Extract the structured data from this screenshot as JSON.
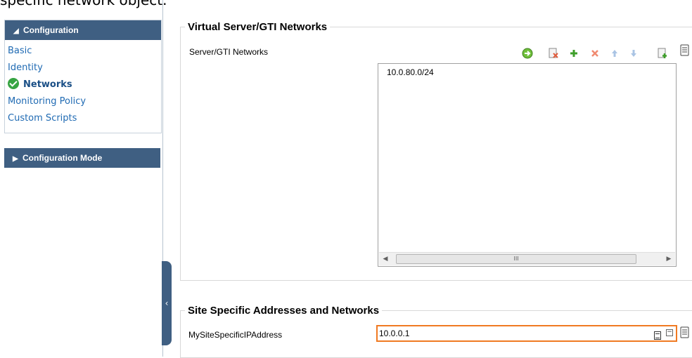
{
  "caption": "specific network object.",
  "sidebar": {
    "configuration_header": "Configuration",
    "items": [
      {
        "label": "Basic"
      },
      {
        "label": "Identity"
      },
      {
        "label": "Networks"
      },
      {
        "label": "Monitoring Policy"
      },
      {
        "label": "Custom Scripts"
      }
    ],
    "mode_header": "Configuration Mode"
  },
  "virtual_networks": {
    "legend": "Virtual Server/GTI Networks",
    "field_label": "Server/GTI Networks",
    "toolbar_icons": [
      "import-icon",
      "remove-all-icon",
      "add-icon",
      "delete-icon",
      "move-up-icon",
      "move-down-icon",
      "export-icon",
      "properties-icon"
    ],
    "entries": [
      "10.0.80.0/24"
    ],
    "scroll_grip": "III"
  },
  "site_specific": {
    "legend": "Site Specific Addresses and Networks",
    "field_label": "MySiteSpecificIPAddress",
    "value": "10.0.0.1"
  },
  "colors": {
    "header_bg": "#3f5f82",
    "link": "#1f6ab3",
    "check": "#37a443",
    "focus_border": "#f07a22"
  }
}
